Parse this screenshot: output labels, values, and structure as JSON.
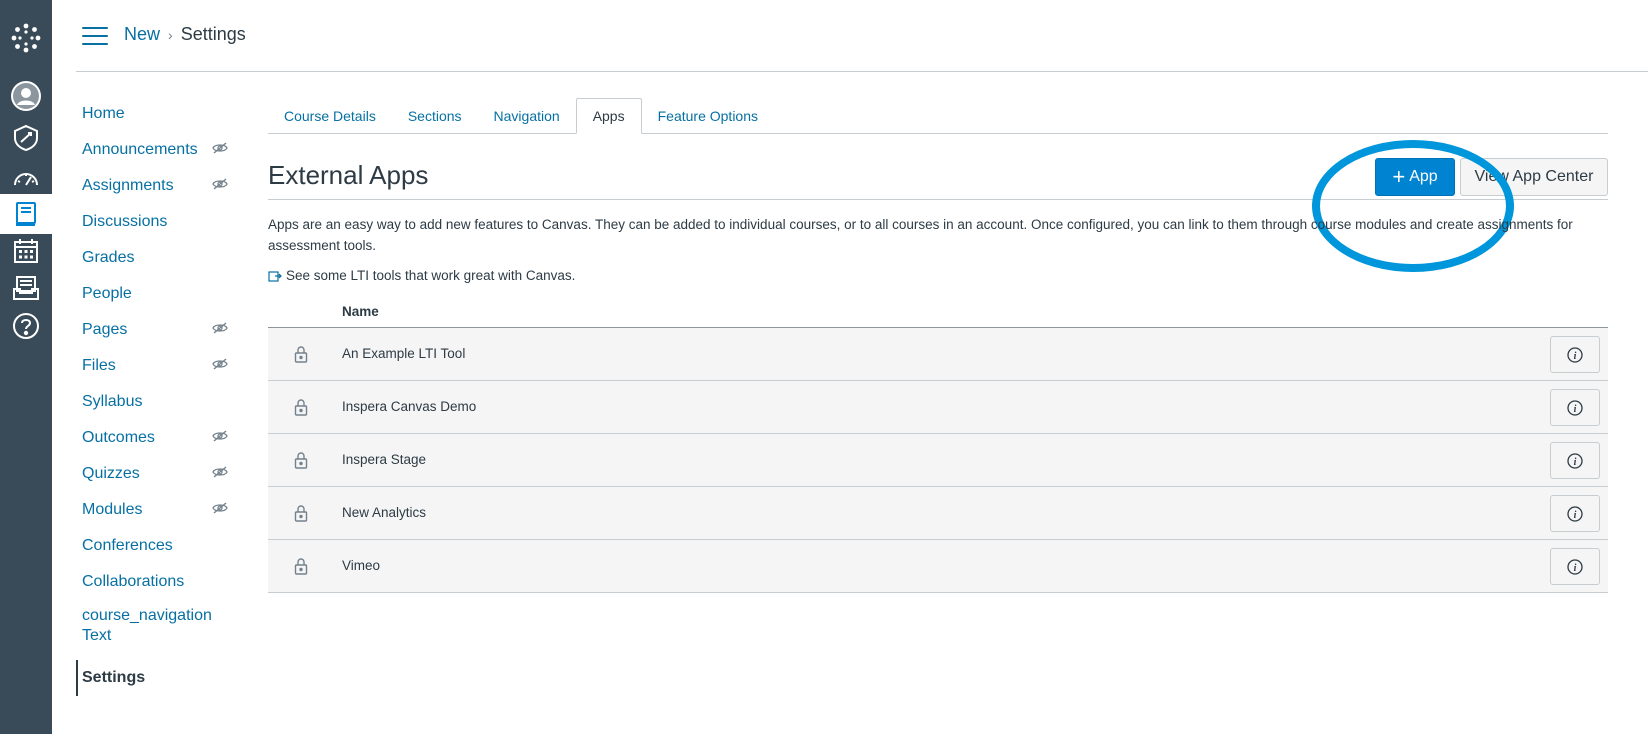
{
  "global_nav": {
    "logo_icon": "canvas-logo-icon",
    "items": [
      {
        "icon": "account-icon"
      },
      {
        "icon": "admin-icon"
      },
      {
        "icon": "dashboard-icon"
      },
      {
        "icon": "courses-icon",
        "active": true
      },
      {
        "icon": "calendar-icon"
      },
      {
        "icon": "inbox-icon"
      },
      {
        "icon": "help-icon"
      }
    ]
  },
  "header": {
    "breadcrumb": {
      "course": "New",
      "separator": "›",
      "current": "Settings"
    }
  },
  "course_nav": {
    "items": [
      {
        "label": "Home"
      },
      {
        "label": "Announcements",
        "hidden": true
      },
      {
        "label": "Assignments",
        "hidden": true
      },
      {
        "label": "Discussions"
      },
      {
        "label": "Grades"
      },
      {
        "label": "People"
      },
      {
        "label": "Pages",
        "hidden": true
      },
      {
        "label": "Files",
        "hidden": true
      },
      {
        "label": "Syllabus"
      },
      {
        "label": "Outcomes",
        "hidden": true
      },
      {
        "label": "Quizzes",
        "hidden": true
      },
      {
        "label": "Modules",
        "hidden": true
      },
      {
        "label": "Conferences"
      },
      {
        "label": "Collaborations"
      },
      {
        "label": "course_navigation Text"
      },
      {
        "label": "Settings",
        "active": true
      }
    ]
  },
  "tabs": [
    {
      "label": "Course Details"
    },
    {
      "label": "Sections"
    },
    {
      "label": "Navigation"
    },
    {
      "label": "Apps",
      "active": true
    },
    {
      "label": "Feature Options"
    }
  ],
  "external_apps": {
    "title": "External Apps",
    "add_button": "App",
    "add_button_icon": "plus-icon",
    "center_button": "View App Center",
    "description": "Apps are an easy way to add new features to Canvas. They can be added to individual courses, or to all courses in an account. Once configured, you can link to them through course modules and create assignments for assessment tools.",
    "lti_link": "See some LTI tools that work great with Canvas.",
    "column_name": "Name",
    "apps": [
      {
        "name": "An Example LTI Tool"
      },
      {
        "name": "Inspera Canvas Demo"
      },
      {
        "name": "Inspera Stage"
      },
      {
        "name": "New Analytics"
      },
      {
        "name": "Vimeo"
      }
    ]
  },
  "colors": {
    "nav_bg": "#394b58",
    "link": "#0770a3",
    "primary_button": "#0084d1",
    "highlight_ring": "#0096db",
    "row_bg": "#f5f5f5"
  }
}
